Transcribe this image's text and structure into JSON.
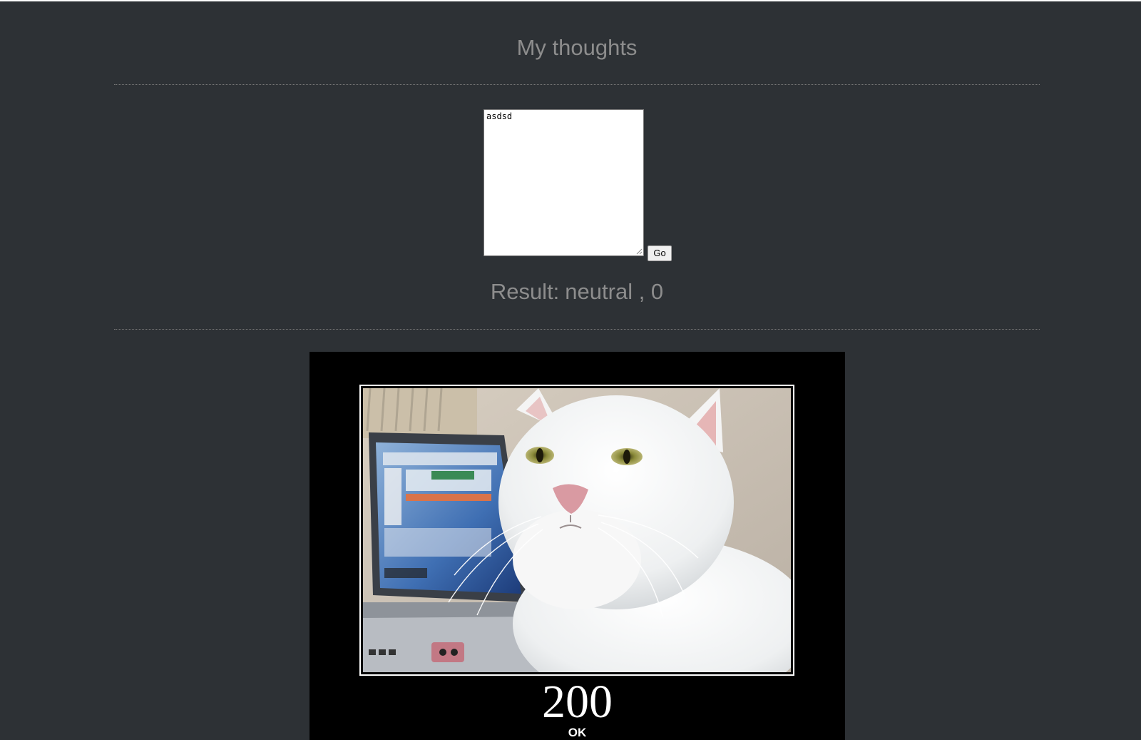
{
  "header": {
    "title": "My thoughts"
  },
  "form": {
    "textarea_value": "asdsd",
    "go_label": "Go"
  },
  "result": {
    "label": "Result:",
    "value": "neutral , 0"
  },
  "meme": {
    "code": "200",
    "caption": "OK",
    "subject": "white-cat-with-laptop"
  },
  "colors": {
    "background": "#2d3135",
    "heading_text": "#8d8d8d",
    "divider": "#777777",
    "meme_background": "#000000"
  }
}
